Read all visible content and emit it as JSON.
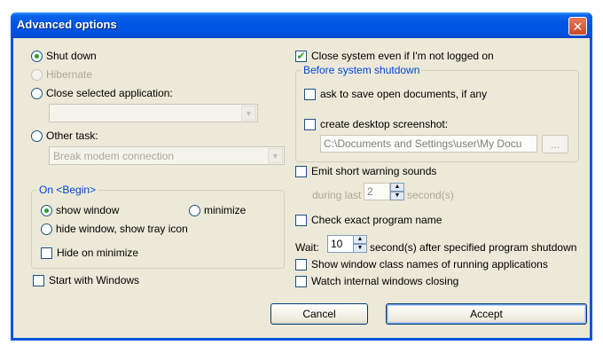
{
  "window": {
    "title": "Advanced options",
    "close_glyph": "✕"
  },
  "left": {
    "shutdown": {
      "label": "Shut down",
      "checked": true
    },
    "hibernate": {
      "label": "Hibernate",
      "disabled": true
    },
    "close_app": {
      "label": "Close selected application:",
      "value": ""
    },
    "other_task": {
      "label": "Other task:",
      "value": "Break modem connection"
    },
    "on_begin": {
      "legend": "On <Begin>",
      "show_window": "show window",
      "minimize": "minimize",
      "hide_window": "hide window, show tray icon",
      "hide_on_minimize": "Hide on minimize"
    },
    "start_with_windows": "Start with Windows"
  },
  "right": {
    "close_system": {
      "label": "Close system even if I'm not logged on",
      "checked": true
    },
    "before_shutdown": {
      "legend": "Before system shutdown",
      "ask_save": "ask to save open documents, if any",
      "create_screenshot": "create desktop screenshot:",
      "screenshot_path": "C:\\Documents and Settings\\user\\My Docu",
      "browse_label": "..."
    },
    "warning_sounds": {
      "label": "Emit short warning sounds",
      "during_last": "during last",
      "value": "2",
      "unit": "second(s)"
    },
    "check_exact": "Check exact program name",
    "wait": {
      "label": "Wait:",
      "value": "10",
      "suffix": "second(s) after specified program shutdown"
    },
    "show_class_names": "Show window class names of running applications",
    "watch_closing": "Watch internal windows closing"
  },
  "buttons": {
    "cancel": "Cancel",
    "accept": "Accept"
  },
  "icons": {
    "check": "✔",
    "dropdown": "▼",
    "spin_up": "▲",
    "spin_down": "▼"
  }
}
